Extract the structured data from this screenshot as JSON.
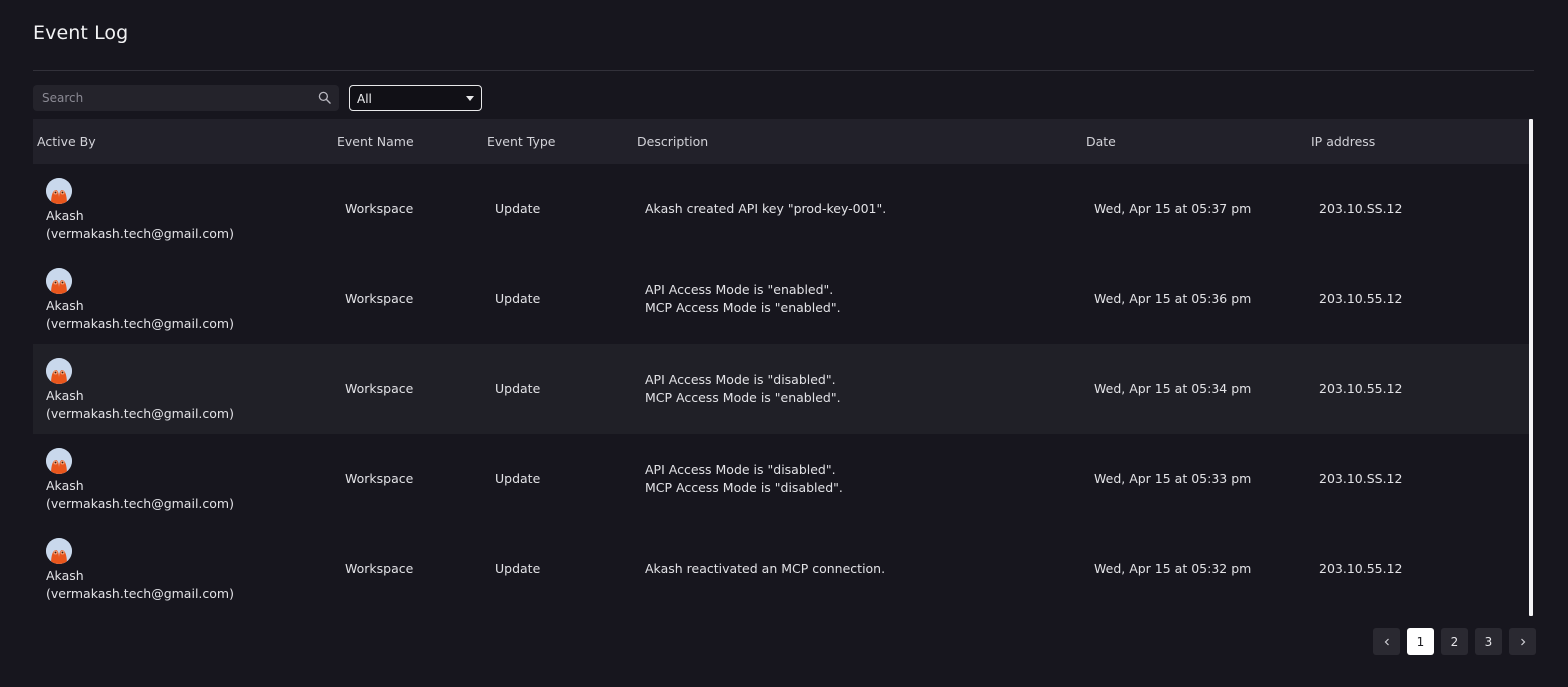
{
  "page": {
    "title": "Event Log"
  },
  "toolbar": {
    "search_placeholder": "Search",
    "search_value": "",
    "filter_value": "All"
  },
  "table": {
    "headers": [
      "Active By",
      "Event Name",
      "Event Type",
      "Description",
      "Date",
      "IP address"
    ],
    "rows": [
      {
        "actor_name": "Akash",
        "actor_email": "(vermakash.tech@gmail.com)",
        "event_name": "Workspace",
        "event_type": "Update",
        "desc_line1": "Akash created API key \"prod-key-001\".",
        "desc_line2": "",
        "date": "Wed, Apr 15 at 05:37 pm",
        "ip": "203.10.SS.12"
      },
      {
        "actor_name": "Akash",
        "actor_email": "(vermakash.tech@gmail.com)",
        "event_name": "Workspace",
        "event_type": "Update",
        "desc_line1": "API Access Mode is \"enabled\".",
        "desc_line2": "MCP Access Mode is \"enabled\".",
        "date": "Wed, Apr 15 at 05:36 pm",
        "ip": "203.10.55.12"
      },
      {
        "actor_name": "Akash",
        "actor_email": "(vermakash.tech@gmail.com)",
        "event_name": "Workspace",
        "event_type": "Update",
        "desc_line1": "API Access Mode is \"disabled\".",
        "desc_line2": "MCP Access Mode is \"enabled\".",
        "date": "Wed, Apr 15 at 05:34 pm",
        "ip": "203.10.55.12"
      },
      {
        "actor_name": "Akash",
        "actor_email": "(vermakash.tech@gmail.com)",
        "event_name": "Workspace",
        "event_type": "Update",
        "desc_line1": "API Access Mode is \"disabled\".",
        "desc_line2": "MCP Access Mode is \"disabled\".",
        "date": "Wed, Apr 15 at 05:33 pm",
        "ip": "203.10.SS.12"
      },
      {
        "actor_name": "Akash",
        "actor_email": "(vermakash.tech@gmail.com)",
        "event_name": "Workspace",
        "event_type": "Update",
        "desc_line1": "Akash reactivated an MCP connection.",
        "desc_line2": "",
        "date": "Wed, Apr 15 at 05:32 pm",
        "ip": "203.10.55.12"
      }
    ]
  },
  "pagination": {
    "prev_icon": "chevron-left-icon",
    "next_icon": "chevron-right-icon",
    "pages": [
      "1",
      "2",
      "3"
    ],
    "current": "1"
  },
  "colors": {
    "background": "#17161e",
    "header_row": "#22212a",
    "alt_row": "#202027",
    "avatar_bg": "#c9d8ec",
    "avatar_fg": "#e8561c",
    "active_page": "#ffffff"
  }
}
